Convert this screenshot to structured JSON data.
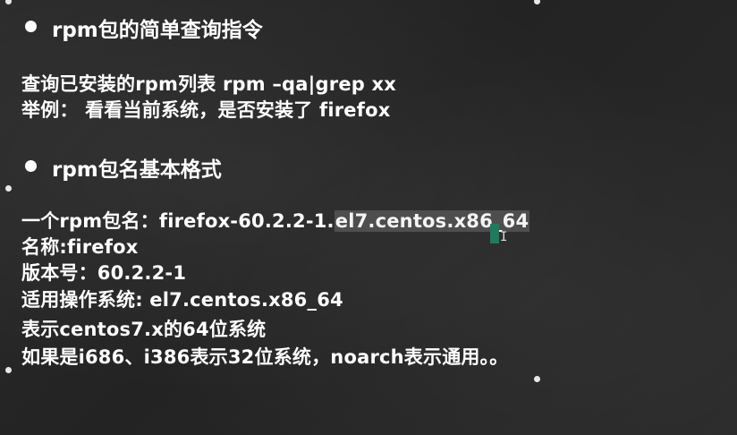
{
  "sections": [
    {
      "heading": "rpm包的简单查询指令"
    },
    {
      "heading": "rpm包名基本格式"
    }
  ],
  "query": {
    "line1": "查询已安装的rpm列表  rpm  –qa|grep xx",
    "line2": "举例： 看看当前系统，是否安装了 firefox"
  },
  "format": {
    "name_prefix": "一个rpm包名：firefox-60.2.2-1.",
    "name_selected": "el7.centos.x86_64",
    "line_name": "名称:firefox",
    "line_version": "版本号：60.2.2-1",
    "line_os": "适用操作系统: el7.centos.x86_64",
    "line_arch": "表示centos7.x的64位系统",
    "line_note": "如果是i686、i386表示32位系统，noarch表示通用。。"
  },
  "cursor_glyph": "I"
}
